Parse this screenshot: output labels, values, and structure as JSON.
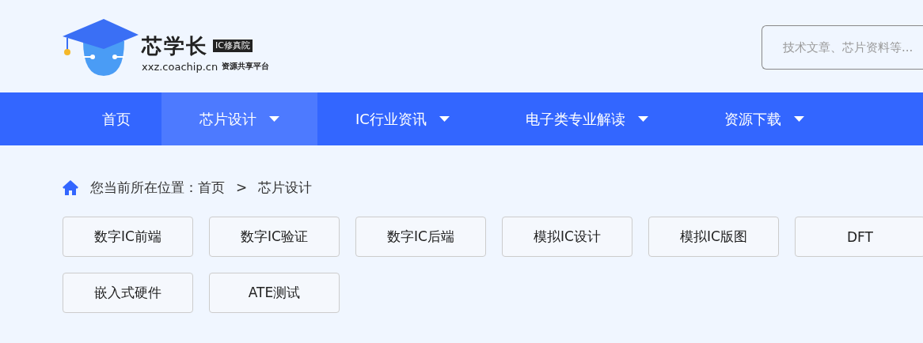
{
  "header": {
    "logo": {
      "name": "芯学长",
      "badge": "IC修真院",
      "domain": "xxz.coachip.cn",
      "slogan": "资源共享平台"
    },
    "search": {
      "placeholder": "技术文章、芯片资料等..."
    }
  },
  "nav": [
    {
      "label": "首页",
      "selected": false,
      "dropdown": false
    },
    {
      "label": "芯片设计",
      "selected": true,
      "dropdown": true
    },
    {
      "label": "IC行业资讯",
      "selected": false,
      "dropdown": true
    },
    {
      "label": "电子类专业解读",
      "selected": false,
      "dropdown": true
    },
    {
      "label": "资源下载",
      "selected": false,
      "dropdown": true
    }
  ],
  "breadcrumb": {
    "prefix": "您当前所在位置：",
    "items": [
      "首页",
      "芯片设计"
    ],
    "separator": ">"
  },
  "categories": [
    "数字IC前端",
    "数字IC验证",
    "数字IC后端",
    "模拟IC设计",
    "模拟IC版图",
    "DFT",
    "嵌入式硬件",
    "ATE测试"
  ]
}
